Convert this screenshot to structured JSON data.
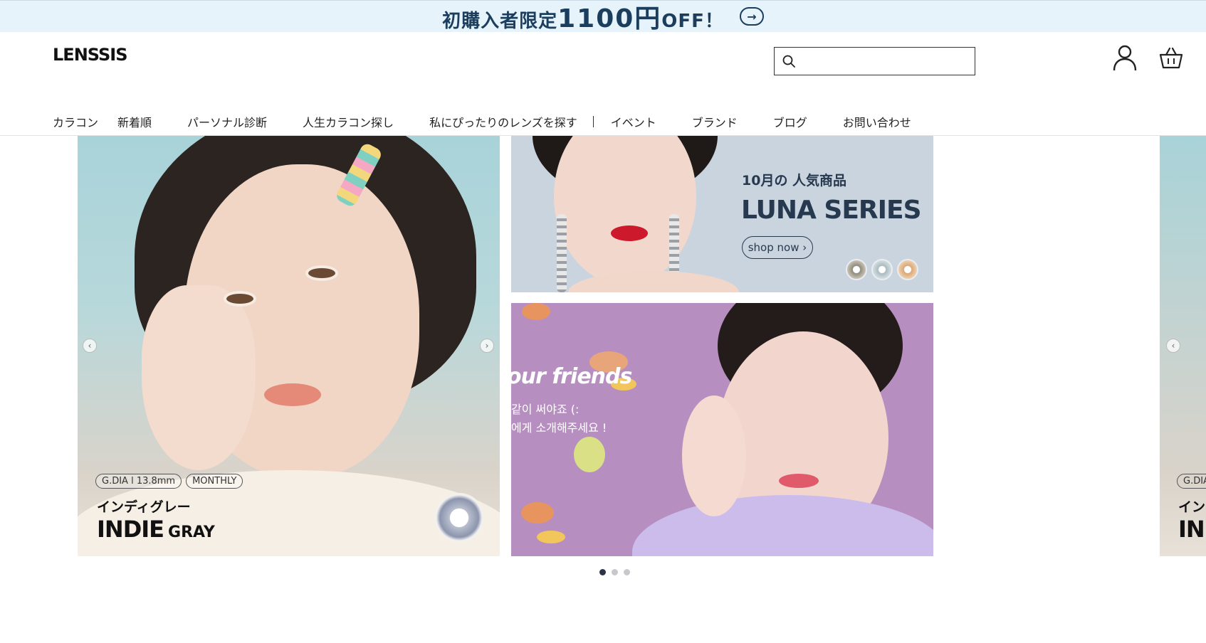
{
  "promo": {
    "text_prefix": "初購入者限定",
    "text_big": "1100円",
    "text_suffix": "OFF！",
    "arrow_glyph": "→"
  },
  "header": {
    "logo": "LENSSIS",
    "search_placeholder": "",
    "search_value": ""
  },
  "nav": {
    "items": [
      "カラコン",
      "新着順",
      "パーソナル診断",
      "人生カラコン探し",
      "私にぴったりのレンズを探す",
      "イベント",
      "ブランド",
      "ブログ",
      "お問い合わせ"
    ]
  },
  "hero": {
    "main_slide": {
      "badge_dia": "G.DIA l 13.8mm",
      "badge_period": "MONTHLY",
      "subtitle": "インディグレー",
      "title": "INDIE",
      "title_small": "GRAY"
    },
    "top_banner": {
      "title_jp": "10月の 人気商品",
      "title_en": "LUNA SERIES",
      "button": "shop now ›"
    },
    "bottom_banner": {
      "headline": "our friends",
      "line1": "같이 써야죠 (:",
      "line2": "에게 소개해주세요 !"
    },
    "peek_slide": {
      "badge": "G.DIA",
      "subtitle": "イン",
      "title": "INI"
    },
    "arrow_prev": "‹",
    "arrow_next": "›"
  },
  "pager": {
    "count": 3,
    "active_index": 0
  },
  "colors": {
    "promo_bg": "#e6f3fb",
    "promo_text": "#1c3e5e",
    "banner_navy": "#27394f",
    "pager_active": "#2b3346"
  }
}
